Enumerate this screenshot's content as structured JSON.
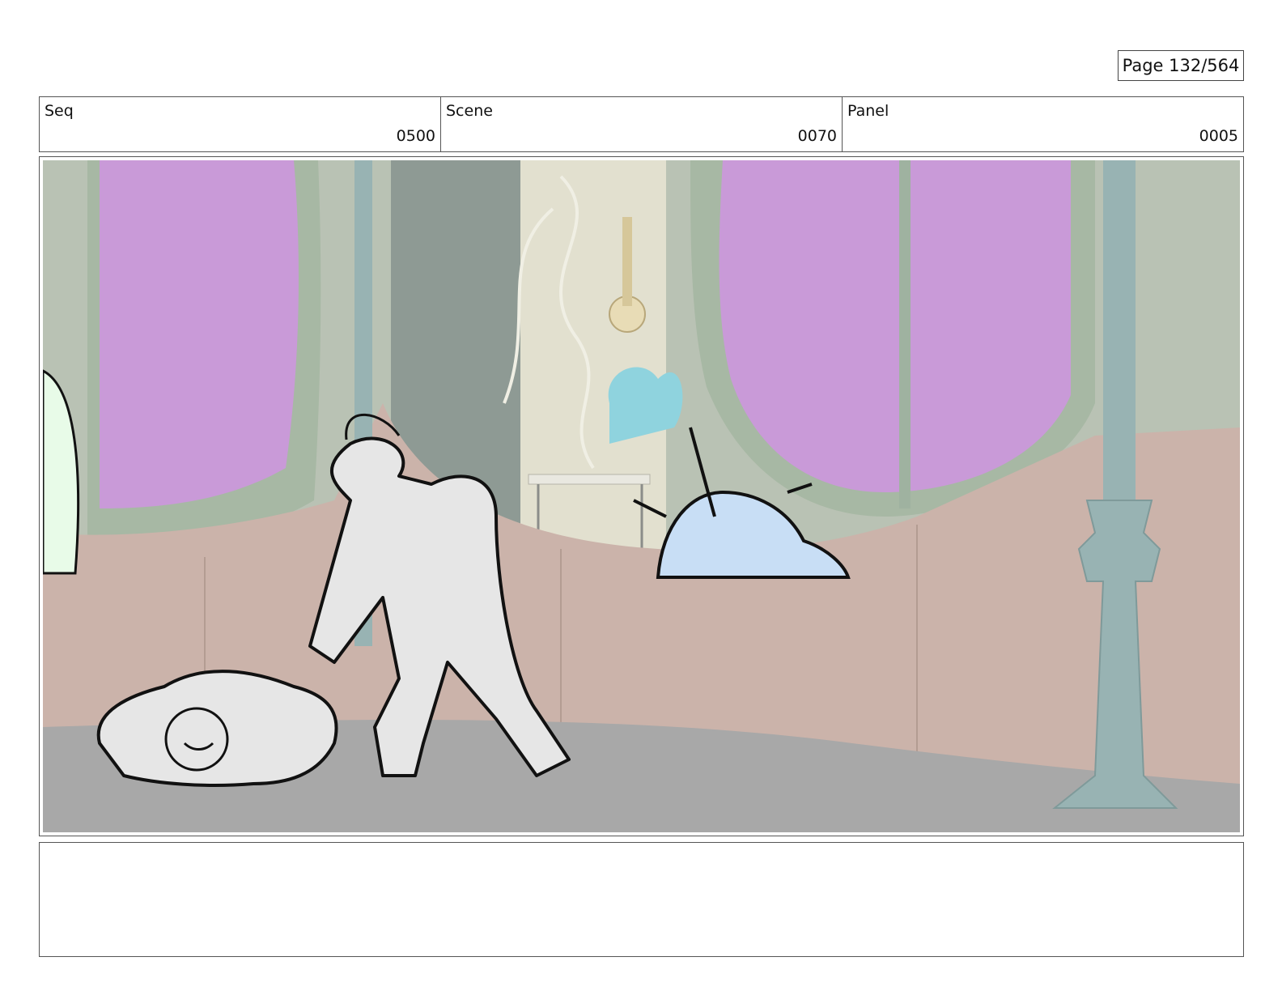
{
  "page": {
    "label": "Page 132/564"
  },
  "header": {
    "seq": {
      "label": "Seq",
      "value": "0500"
    },
    "scene": {
      "label": "Scene",
      "value": "0070"
    },
    "panel": {
      "label": "Panel",
      "value": "0005"
    }
  },
  "notes": {
    "text": ""
  },
  "colors": {
    "window_purple": "#c99ad8",
    "wall_tan": "#cbb3aa",
    "frame_green": "#a7b8a4",
    "floor_gray": "#a8a8a8",
    "pillar_teal": "#98b3b3",
    "pony_blue": "#c8def5"
  }
}
